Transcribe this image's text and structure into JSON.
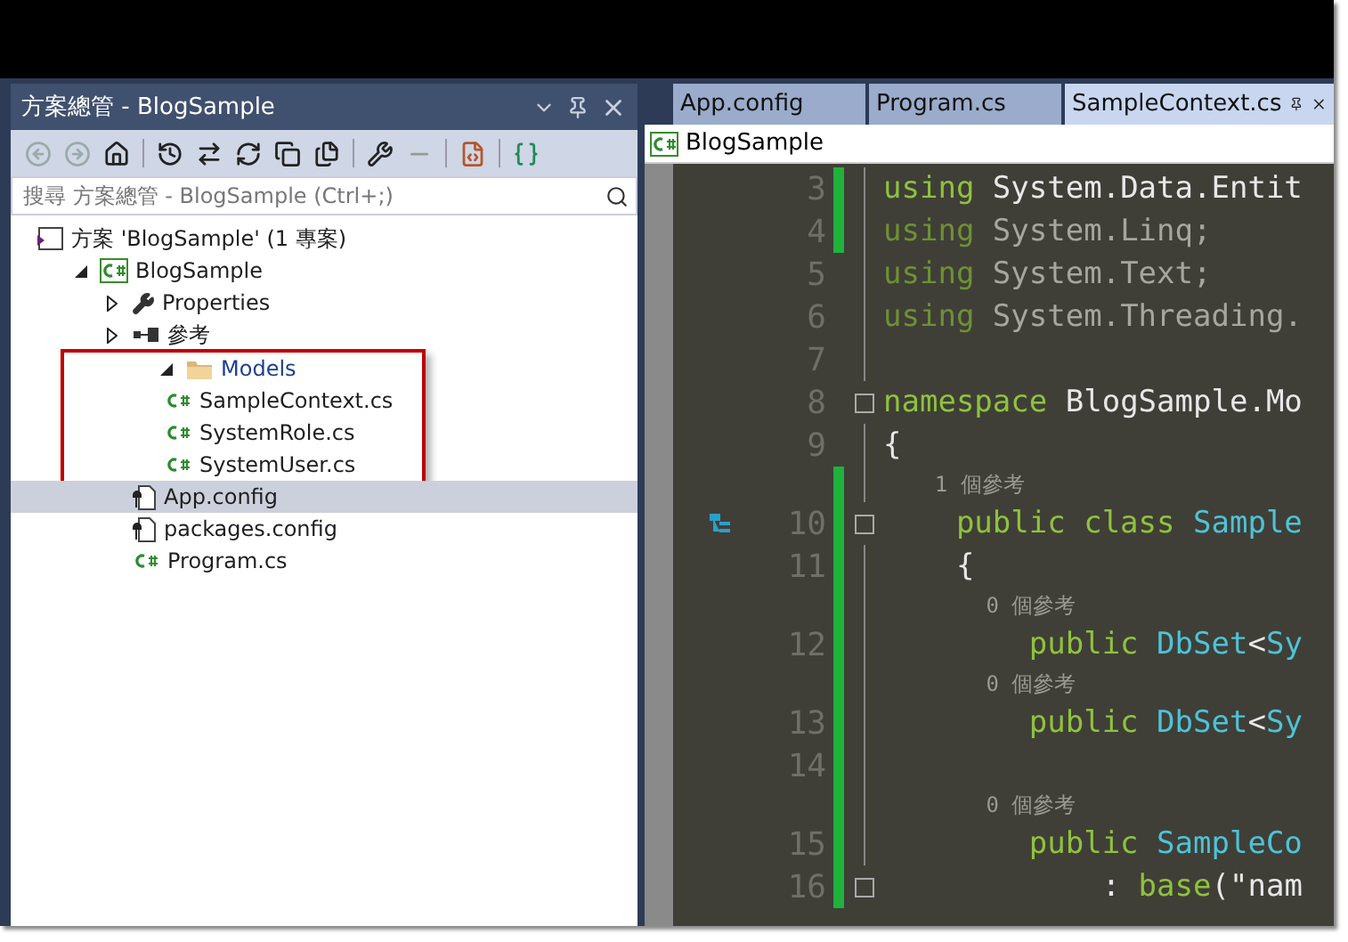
{
  "solution_explorer": {
    "title": "方案總管 - BlogSample",
    "search": {
      "placeholder": "搜尋 方案總管 - BlogSample (Ctrl+;)"
    },
    "tree": [
      {
        "label": "方案 'BlogSample' (1 專案)",
        "kind": "solution",
        "selected": false,
        "children": [
          {
            "label": "BlogSample",
            "kind": "project",
            "expanded": true,
            "selected": false,
            "children": [
              {
                "label": "Properties",
                "kind": "properties",
                "expanded": false,
                "selected": false
              },
              {
                "label": "參考",
                "kind": "references",
                "expanded": false,
                "selected": false
              },
              {
                "label": "Models",
                "kind": "folder",
                "expanded": true,
                "selected": false,
                "highlighted": true,
                "children": [
                  {
                    "label": "SampleContext.cs",
                    "kind": "csharp",
                    "selected": false
                  },
                  {
                    "label": "SystemRole.cs",
                    "kind": "csharp",
                    "selected": false
                  },
                  {
                    "label": "SystemUser.cs",
                    "kind": "csharp",
                    "selected": false
                  }
                ]
              },
              {
                "label": "App.config",
                "kind": "config",
                "selected": true
              },
              {
                "label": "packages.config",
                "kind": "config",
                "selected": false
              },
              {
                "label": "Program.cs",
                "kind": "csharp",
                "selected": false
              }
            ]
          }
        ]
      }
    ]
  },
  "editor": {
    "tabs": [
      {
        "label": "App.config",
        "selected": false
      },
      {
        "label": "Program.cs",
        "selected": false
      },
      {
        "label": "SampleContext.cs",
        "selected": true
      }
    ],
    "navigation": {
      "project": "BlogSample"
    },
    "lines": [
      {
        "kind": "code",
        "number": "3",
        "changed": true,
        "foldable": false,
        "tokens": [
          {
            "kind": "keyword",
            "s": "using"
          },
          {
            "kind": "plain",
            "s": " System.Data.Entit"
          }
        ]
      },
      {
        "kind": "code",
        "number": "4",
        "changed": true,
        "foldable": false,
        "tokens": [
          {
            "kind": "keyword-dim",
            "s": "using"
          },
          {
            "kind": "dim",
            "s": " System.Linq;"
          }
        ]
      },
      {
        "kind": "code",
        "number": "5",
        "changed": false,
        "foldable": false,
        "tokens": [
          {
            "kind": "keyword-dim",
            "s": "using"
          },
          {
            "kind": "dim",
            "s": " System.Text;"
          }
        ]
      },
      {
        "kind": "code",
        "number": "6",
        "changed": false,
        "foldable": false,
        "tokens": [
          {
            "kind": "keyword-dim",
            "s": "using"
          },
          {
            "kind": "dim",
            "s": " System.Threading."
          }
        ]
      },
      {
        "kind": "code",
        "number": "7",
        "changed": false,
        "foldable": false
      },
      {
        "kind": "code",
        "number": "8",
        "changed": false,
        "foldable": true,
        "tokens": [
          {
            "kind": "keyword",
            "s": "namespace"
          },
          {
            "kind": "plain",
            "s": " BlogSample.Mo"
          }
        ]
      },
      {
        "kind": "code",
        "number": "9",
        "changed": false,
        "foldable": false,
        "tokens": [
          {
            "kind": "plain",
            "s": "{"
          }
        ]
      },
      {
        "kind": "lens",
        "changed": true,
        "text": "    1 個參考"
      },
      {
        "kind": "code",
        "number": "10",
        "changed": true,
        "foldable": true,
        "margin_icon": true,
        "tokens": [
          {
            "kind": "keyword",
            "s": "    public class"
          },
          {
            "kind": "type",
            "s": " Sample"
          }
        ]
      },
      {
        "kind": "code",
        "number": "11",
        "changed": true,
        "foldable": false,
        "tokens": [
          {
            "kind": "plain",
            "s": "    {"
          }
        ]
      },
      {
        "kind": "lens",
        "changed": true,
        "text": "        0 個參考"
      },
      {
        "kind": "code",
        "number": "12",
        "changed": true,
        "foldable": false,
        "tokens": [
          {
            "kind": "keyword",
            "s": "        public"
          },
          {
            "kind": "type",
            "s": " DbSet"
          },
          {
            "kind": "plain",
            "s": "<"
          },
          {
            "kind": "type",
            "s": "Sy"
          }
        ]
      },
      {
        "kind": "lens",
        "changed": true,
        "text": "        0 個參考"
      },
      {
        "kind": "code",
        "number": "13",
        "changed": true,
        "foldable": false,
        "tokens": [
          {
            "kind": "keyword",
            "s": "        public"
          },
          {
            "kind": "type",
            "s": " DbSet"
          },
          {
            "kind": "plain",
            "s": "<"
          },
          {
            "kind": "type",
            "s": "Sy"
          }
        ]
      },
      {
        "kind": "code",
        "number": "14",
        "changed": true,
        "foldable": false
      },
      {
        "kind": "lens",
        "changed": true,
        "text": "        0 個參考"
      },
      {
        "kind": "code",
        "number": "15",
        "changed": true,
        "foldable": false,
        "tokens": [
          {
            "kind": "keyword",
            "s": "        public"
          },
          {
            "kind": "type",
            "s": " SampleCo"
          }
        ]
      },
      {
        "kind": "code",
        "number": "16",
        "changed": true,
        "foldable": true,
        "tokens": [
          {
            "kind": "plain",
            "s": "            : "
          },
          {
            "kind": "keyword",
            "s": "base"
          },
          {
            "kind": "plain",
            "s": "(\"nam"
          }
        ]
      }
    ]
  }
}
